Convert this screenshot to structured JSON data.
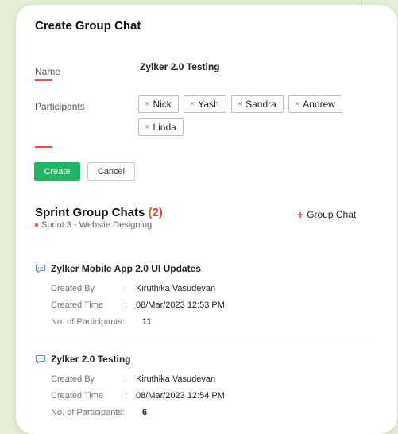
{
  "form": {
    "title": "Create Group Chat",
    "name_label": "Name",
    "name_value": "Zylker 2.0 Testing",
    "participants_label": "Participants",
    "participants": [
      "Nick",
      "Yash",
      "Sandra",
      "Andrew",
      "Linda"
    ],
    "remove_glyph": "×",
    "create_label": "Create",
    "cancel_label": "Cancel"
  },
  "section": {
    "title": "Sprint Group Chats",
    "count": "(2)",
    "sprint": "Sprint 3 - Website Designing",
    "add_plus": "+",
    "add_label": "Group Chat"
  },
  "chats": [
    {
      "title": "Zylker Mobile App 2.0 UI Updates",
      "created_by_label": "Created By",
      "created_by": "Kiruthika Vasudevan",
      "created_time_label": "Created Time",
      "created_time": "08/Mar/2023 12:53 PM",
      "participants_label": "No. of Participants:",
      "participants_count": "11"
    },
    {
      "title": "Zylker 2.0 Testing",
      "created_by_label": "Created By",
      "created_by": "Kiruthika Vasudevan",
      "created_time_label": "Created Time",
      "created_time": "08/Mar/2023 12:54 PM",
      "participants_label": "No. of Participants:",
      "participants_count": "6"
    }
  ],
  "separator": ":",
  "colors": {
    "accent": "#e0483c",
    "create_button": "#1fb565",
    "chat_icon": "#5a8fd6",
    "background": "#e8efd9"
  },
  "icons": {
    "chat": "chat-bubble-icon",
    "remove": "remove-icon",
    "add": "plus-icon"
  }
}
